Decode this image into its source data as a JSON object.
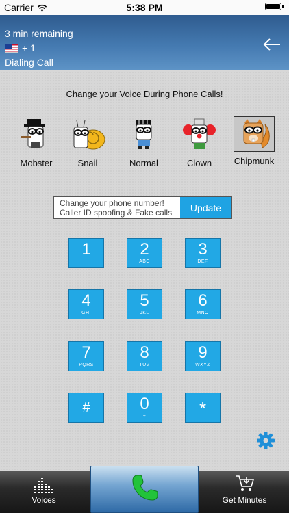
{
  "status_bar": {
    "carrier": "Carrier",
    "time": "5:38 PM"
  },
  "header": {
    "remaining": "3 min remaining",
    "country_code": "+ 1",
    "status": "Dialing Call"
  },
  "tagline": "Change your Voice During Phone Calls!",
  "voices": [
    {
      "label": "Mobster",
      "icon": "mobster-icon"
    },
    {
      "label": "Snail",
      "icon": "snail-icon"
    },
    {
      "label": "Normal",
      "icon": "normal-icon"
    },
    {
      "label": "Clown",
      "icon": "clown-icon"
    },
    {
      "label": "Chipmunk",
      "icon": "chipmunk-icon",
      "selected": true
    }
  ],
  "promo": {
    "line1": "Change your phone number!",
    "line2": "Caller ID spoofing & Fake calls",
    "button": "Update"
  },
  "keypad": [
    {
      "digit": "1",
      "letters": ""
    },
    {
      "digit": "2",
      "letters": "ABC"
    },
    {
      "digit": "3",
      "letters": "DEF"
    },
    {
      "digit": "4",
      "letters": "GHI"
    },
    {
      "digit": "5",
      "letters": "JKL"
    },
    {
      "digit": "6",
      "letters": "MNO"
    },
    {
      "digit": "7",
      "letters": "PQRS"
    },
    {
      "digit": "8",
      "letters": "TUV"
    },
    {
      "digit": "9",
      "letters": "WXYZ"
    },
    {
      "digit": "#",
      "letters": ""
    },
    {
      "digit": "0",
      "letters": "+"
    },
    {
      "digit": "*",
      "letters": ""
    }
  ],
  "bottom_bar": {
    "voices_label": "Voices",
    "minutes_label": "Get Minutes"
  },
  "colors": {
    "header": "#4479b0",
    "key": "#22a8e5",
    "update": "#1fa3e3",
    "call_icon": "#22c33a",
    "settings_icon": "#1f8fd8"
  }
}
